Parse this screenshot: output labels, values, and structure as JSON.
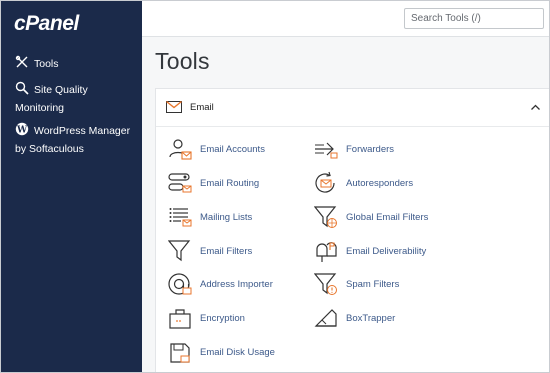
{
  "sidebar": {
    "logo": "cPanel",
    "items": [
      {
        "label": "Tools",
        "icon": "tools-icon"
      },
      {
        "label": "Site Quality Monitoring",
        "icon": "search-icon"
      },
      {
        "label": "WordPress Manager by Softaculous",
        "icon": "wordpress-icon"
      }
    ]
  },
  "header": {
    "search_placeholder": "Search Tools (/)"
  },
  "main": {
    "title": "Tools",
    "section": {
      "title": "Email",
      "icon": "envelope-icon",
      "tools": [
        {
          "label": "Email Accounts",
          "icon": "email-accounts-icon"
        },
        {
          "label": "Forwarders",
          "icon": "forwarders-icon"
        },
        {
          "label": "Email Routing",
          "icon": "email-routing-icon"
        },
        {
          "label": "Autoresponders",
          "icon": "autoresponders-icon"
        },
        {
          "label": "Mailing Lists",
          "icon": "mailing-lists-icon"
        },
        {
          "label": "Global Email Filters",
          "icon": "global-filters-icon"
        },
        {
          "label": "Email Filters",
          "icon": "email-filters-icon"
        },
        {
          "label": "Email Deliverability",
          "icon": "mailbox-icon"
        },
        {
          "label": "Address Importer",
          "icon": "address-importer-icon"
        },
        {
          "label": "Spam Filters",
          "icon": "spam-filters-icon"
        },
        {
          "label": "Encryption",
          "icon": "encryption-icon"
        },
        {
          "label": "BoxTrapper",
          "icon": "boxtrapper-icon"
        },
        {
          "label": "Email Disk Usage",
          "icon": "disk-usage-icon"
        }
      ]
    }
  },
  "colors": {
    "sidebar_bg": "#1b2a4a",
    "link": "#3d5a8a",
    "accent_orange": "#e8762c"
  }
}
